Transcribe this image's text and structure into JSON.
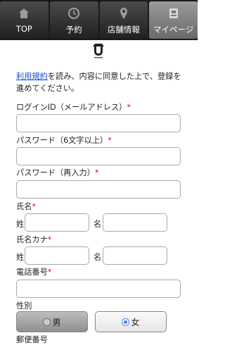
{
  "nav": {
    "items": [
      {
        "label": "TOP",
        "icon": "home-icon"
      },
      {
        "label": "予約",
        "icon": "clock-icon"
      },
      {
        "label": "店舗情報",
        "icon": "map-pin-icon"
      },
      {
        "label": "マイページ",
        "icon": "mypage-icon"
      }
    ],
    "active_index": 3
  },
  "intro": {
    "link": "利用規約",
    "text": "を読み、内容に同意した上で、登録を進めてください。"
  },
  "form": {
    "login_id_label": "ログインID（メールアドレス）",
    "password_label": "パスワード（6文字以上）",
    "password_confirm_label": "パスワード（再入力）",
    "name_label": "氏名",
    "name_kana_label": "氏名カナ",
    "last_name_label": "姓",
    "first_name_label": "名",
    "phone_label": "電話番号",
    "gender_label": "性別",
    "required_mark": "*",
    "gender_options": [
      "男",
      "女"
    ],
    "gender_selected": "女",
    "next_label_partial": "郵便番号"
  },
  "colors": {
    "nav_bg": "#1a1a1a",
    "link": "#1a4fd0",
    "required": "#dd1111",
    "radio_on": "#3b86dd"
  }
}
